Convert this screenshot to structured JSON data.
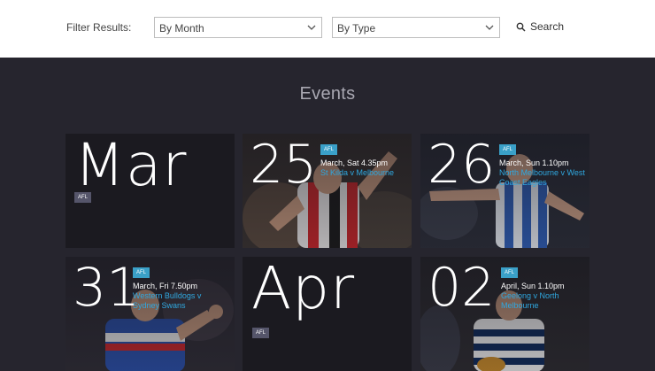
{
  "filters": {
    "label": "Filter Results:",
    "month_select": "By Month",
    "type_select": "By Type",
    "search_label": "Search"
  },
  "events_title": "Events",
  "months": [
    {
      "name": "Mar",
      "tag": "AFL"
    },
    {
      "name": "Apr",
      "tag": "AFL"
    }
  ],
  "events": [
    {
      "day": "25",
      "tag": "AFL",
      "when": "March, Sat 4.35pm",
      "match": "St Kilda v Melbourne"
    },
    {
      "day": "26",
      "tag": "AFL",
      "when": "March, Sun 1.10pm",
      "match": "North Melbourne v West Coast Eagles"
    },
    {
      "day": "31",
      "tag": "AFL",
      "when": "March, Fri 7.50pm",
      "match": "Western Bulldogs v Sydney Swans"
    },
    {
      "day": "02",
      "tag": "AFL",
      "when": "April, Sun 1.10pm",
      "match": "Geelong v North Melbourne"
    }
  ],
  "colors": {
    "tag_blue": "#3aa0c8",
    "link_blue": "#2fa8e0",
    "page_bg": "#26252e"
  }
}
